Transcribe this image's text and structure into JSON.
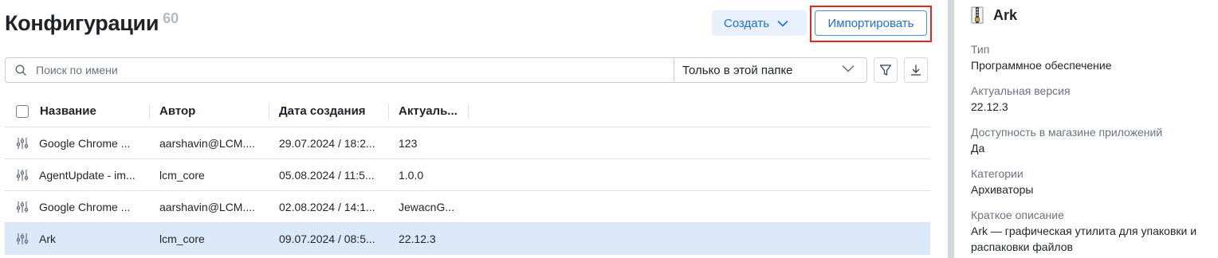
{
  "header": {
    "title": "Конфигурации",
    "count": "60",
    "create_label": "Создать",
    "import_label": "Импортировать"
  },
  "search": {
    "placeholder": "Поиск по имени",
    "scope_value": "Только в этой папке"
  },
  "table": {
    "columns": [
      "Название",
      "Автор",
      "Дата создания",
      "Актуаль..."
    ],
    "rows": [
      {
        "name": "Google Chrome ...",
        "author": "aarshavin@LCM....",
        "date": "29.07.2024 / 18:2...",
        "version": "123",
        "selected": false
      },
      {
        "name": "AgentUpdate - im...",
        "author": "lcm_core",
        "date": "05.08.2024 / 11:5...",
        "version": "1.0.0",
        "selected": false
      },
      {
        "name": "Google Chrome ...",
        "author": "aarshavin@LCM....",
        "date": "02.08.2024 / 14:1...",
        "version": "JewacnG...",
        "selected": false
      },
      {
        "name": "Ark",
        "author": "lcm_core",
        "date": "09.07.2024 / 08:5...",
        "version": "22.12.3",
        "selected": true
      }
    ]
  },
  "panel": {
    "title": "Ark",
    "fields": [
      {
        "label": "Тип",
        "value": "Программное обеспечение"
      },
      {
        "label": "Актуальная версия",
        "value": "22.12.3"
      },
      {
        "label": "Доступность в магазине приложений",
        "value": "Да"
      },
      {
        "label": "Категории",
        "value": "Архиваторы"
      },
      {
        "label": "Краткое описание",
        "value": "Ark — графическая утилита для упаковки и распаковки файлов"
      }
    ]
  },
  "colors": {
    "accent": "#1f6fd6",
    "highlight_border": "#e0281e",
    "selected_row": "#dbe8fa"
  }
}
